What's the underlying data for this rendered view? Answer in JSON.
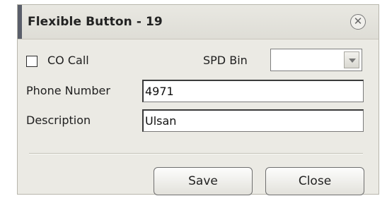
{
  "dialog": {
    "title": "Flexible Button - 19",
    "close_icon": "circle-x-icon"
  },
  "form": {
    "co_call_label": "CO Call",
    "co_call_checked": false,
    "spd_bin_label": "SPD Bin",
    "spd_bin_value": "",
    "phone_label": "Phone Number",
    "phone_value": "4971",
    "description_label": "Description",
    "description_value": "Ulsan"
  },
  "buttons": {
    "save_label": "Save",
    "close_label": "Close"
  }
}
